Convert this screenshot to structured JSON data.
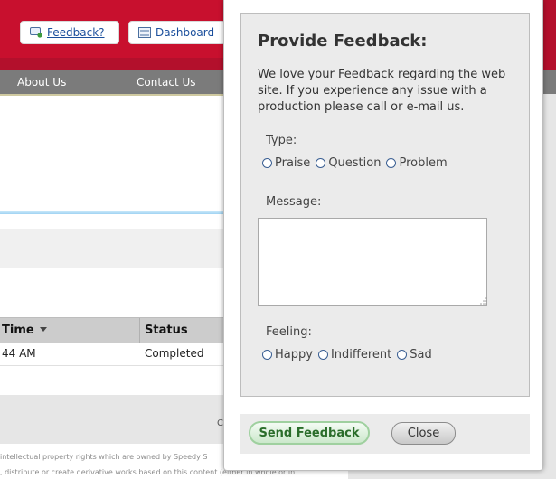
{
  "header": {
    "feedback_label": "Feedback?",
    "dashboard_label": "Dashboard"
  },
  "nav": {
    "about": "About Us",
    "contact": "Contact Us"
  },
  "table": {
    "columns": [
      "Time",
      "Status"
    ],
    "rows": [
      {
        "time": "44 AM",
        "status": "Completed"
      }
    ]
  },
  "footer": {
    "letter": "C",
    "line1": "intellectual property rights which are owned by Speedy S",
    "line2": ", distribute or create derivative works based on this content (either in whole or in"
  },
  "modal": {
    "title": "Provide Feedback:",
    "description": "We love your Feedback regarding the web site. If you experience any issue with a production please call or e-mail us.",
    "type_label": "Type:",
    "type_options": [
      "Praise",
      "Question",
      "Problem"
    ],
    "message_label": "Message:",
    "message_value": "",
    "feeling_label": "Feeling:",
    "feeling_options": [
      "Happy",
      "Indifferent",
      "Sad"
    ],
    "send_label": "Send Feedback",
    "close_label": "Close"
  },
  "colors": {
    "brand_red": "#c8102e",
    "nav_gray": "#7b7b7b",
    "send_green": "#2a6d2a"
  },
  "icons": {
    "feedback": "feedback-icon",
    "dashboard": "dashboard-icon"
  }
}
